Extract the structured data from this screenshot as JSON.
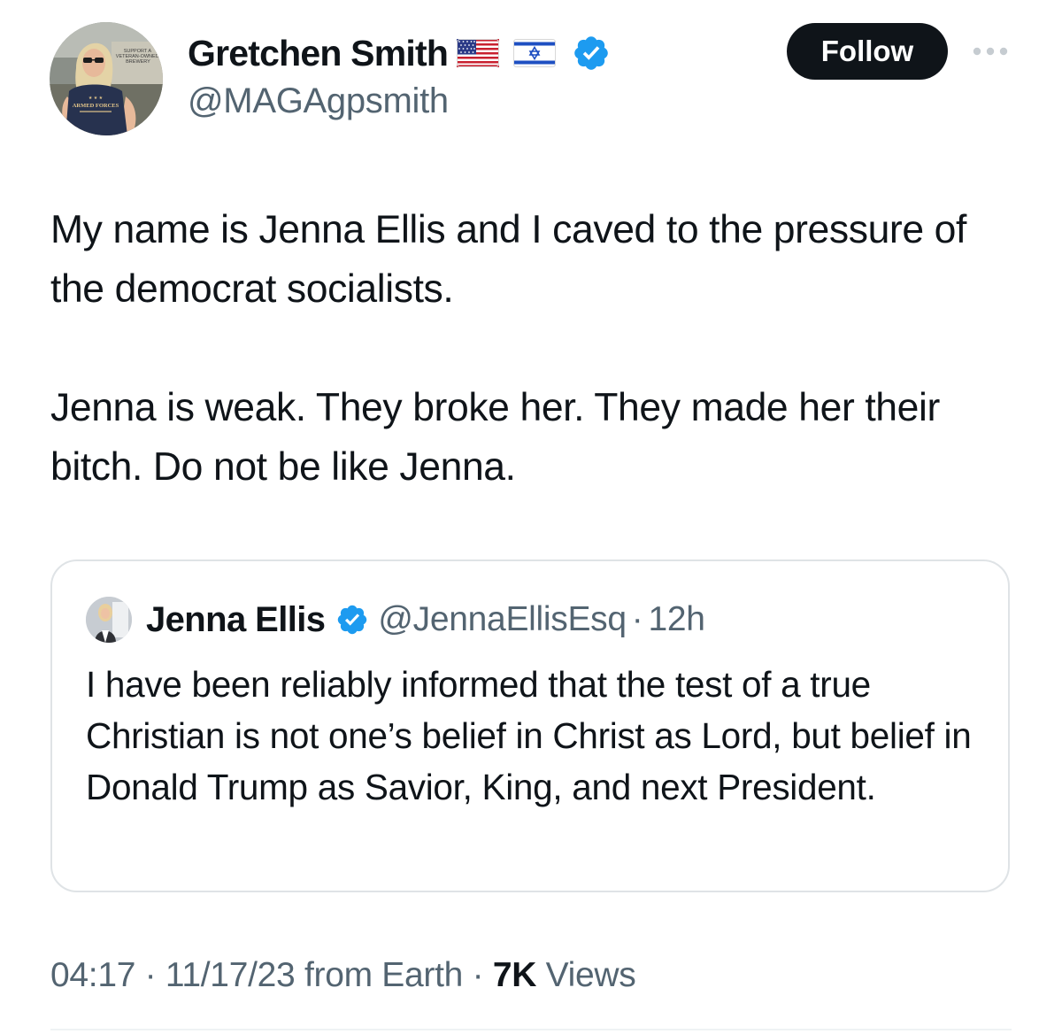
{
  "author": {
    "display_name": "Gretchen Smith",
    "handle": "@MAGAgpsmith",
    "name_emojis": [
      "us-flag-icon",
      "israel-flag-icon"
    ],
    "verified_icon": "verified-badge-icon",
    "avatar_shirt_text": "ARMED FORCES",
    "avatar_sign_text": "SUPPORT A VETERAN-OWNED BREWERY"
  },
  "actions": {
    "follow_label": "Follow",
    "more_icon": "more-horizontal-icon"
  },
  "tweet": {
    "paragraphs": [
      "My name is Jenna Ellis and I caved to the pressure of the democrat socialists.",
      "Jenna is weak. They broke her. They made her their bitch. Do not be like Jenna."
    ]
  },
  "quoted_tweet": {
    "display_name": "Jenna Ellis",
    "handle": "@JennaEllisEsq",
    "separator": "·",
    "time": "12h",
    "text": "I have been reliably informed that the test of a true Christian is not one’s belief in Christ as Lord, but belief in Donald Trump as Savior, King, and next President."
  },
  "meta": {
    "time": "04:17",
    "date": "11/17/23",
    "location": "from Earth",
    "separator": "·",
    "views_count": "7K",
    "views_label": "Views"
  },
  "colors": {
    "text_primary": "#0f1419",
    "text_secondary": "#536471",
    "verified_blue": "#1d9bf0",
    "follow_bg": "#0f1419",
    "card_border": "#dfe3e6"
  }
}
